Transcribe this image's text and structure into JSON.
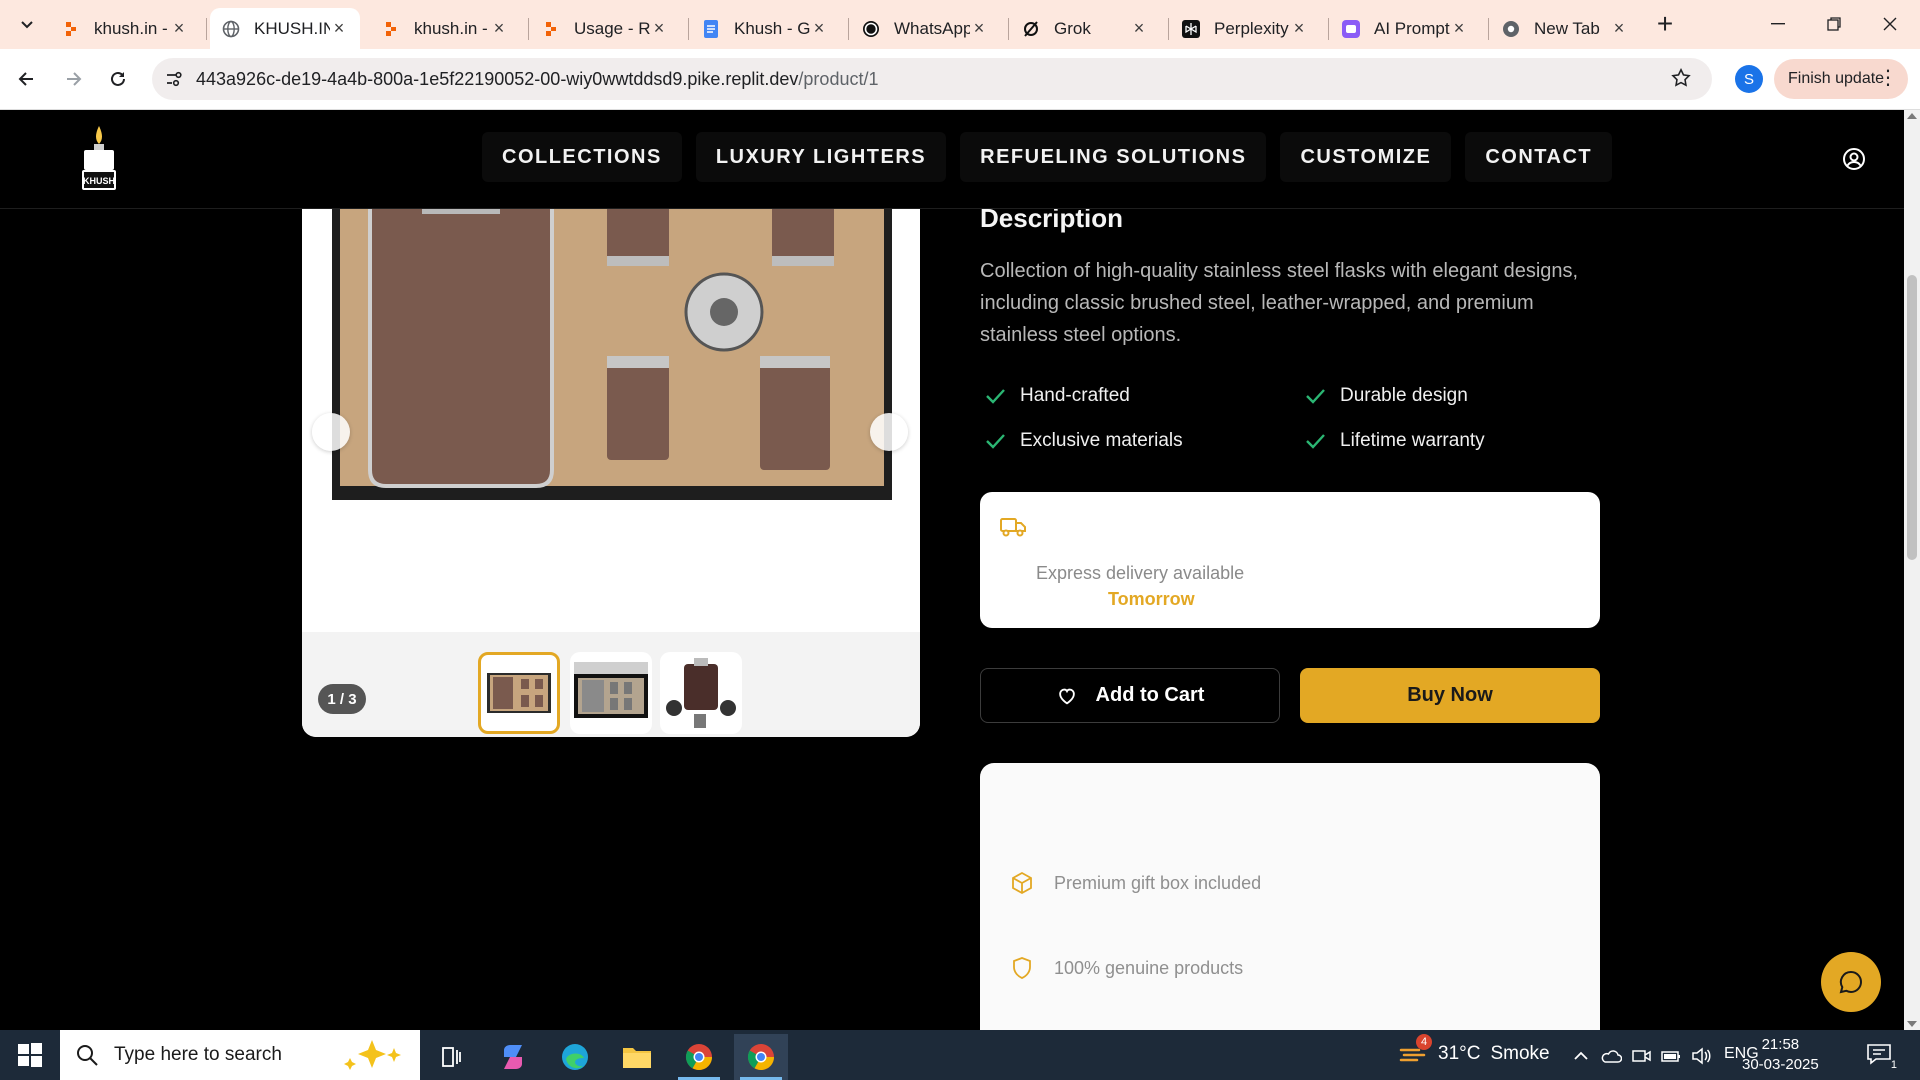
{
  "browser": {
    "tabs": [
      {
        "title": "khush.in - ",
        "icon": "replit-icon"
      },
      {
        "title": "KHUSH.IN",
        "icon": "globe-icon",
        "active": true
      },
      {
        "title": "khush.in - ",
        "icon": "replit-icon"
      },
      {
        "title": "Usage - Re",
        "icon": "replit-icon"
      },
      {
        "title": "Khush - Go",
        "icon": "docs-icon"
      },
      {
        "title": "WhatsApp",
        "icon": "whatsapp-icon"
      },
      {
        "title": "Grok",
        "icon": "grok-icon"
      },
      {
        "title": "Perplexity",
        "icon": "perplexity-icon"
      },
      {
        "title": "AI Prompt",
        "icon": "ai-prompt-icon"
      },
      {
        "title": "New Tab",
        "icon": "chrome-icon"
      }
    ],
    "url_host": "443a926c-de19-4a4b-800a-1e5f22190052-00-wiy0wwtddsd9.pike.replit.dev",
    "url_path": "/product/1",
    "profile_initial": "S",
    "finish_update_label": "Finish update"
  },
  "site": {
    "logo_text": "KHUSH",
    "nav": [
      "COLLECTIONS",
      "LUXURY LIGHTERS",
      "REFUELING SOLUTIONS",
      "CUSTOMIZE",
      "CONTACT"
    ]
  },
  "product": {
    "image_counter": "1 / 3",
    "description_title": "Description",
    "description": "Collection of high-quality stainless steel flasks with elegant designs, including classic brushed steel, leather-wrapped, and premium stainless steel options.",
    "features": [
      "Hand-crafted",
      "Durable design",
      "Exclusive materials",
      "Lifetime warranty"
    ],
    "delivery_label": "Express delivery available",
    "delivery_when": "Tomorrow",
    "add_to_cart_label": "Add to Cart",
    "buy_now_label": "Buy Now",
    "info_items": [
      "Premium gift box included",
      "100% genuine products"
    ]
  },
  "colors": {
    "accent": "#e3a824",
    "check": "#2bb673"
  },
  "taskbar": {
    "search_placeholder": "Type here to search",
    "weather_temp": "31°C",
    "weather_text": "Smoke",
    "weather_badge": "4",
    "language": "ENG",
    "time": "21:58",
    "date": "30-03-2025",
    "notification_count": "1"
  }
}
